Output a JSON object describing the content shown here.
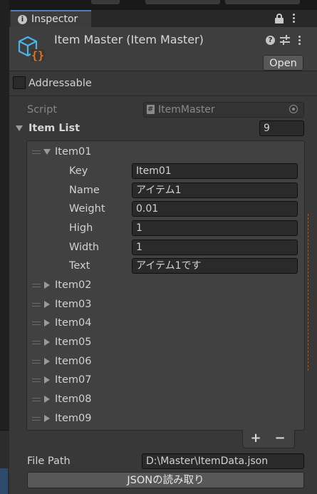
{
  "tab": {
    "title": "Inspector"
  },
  "header": {
    "title": "Item Master (Item Master)",
    "open_label": "Open"
  },
  "addressable": {
    "label": "Addressable",
    "checked": false
  },
  "script": {
    "label": "Script",
    "value": "ItemMaster"
  },
  "item_list": {
    "label": "Item List",
    "count": "9",
    "expanded_item": {
      "name": "Item01",
      "fields": [
        {
          "label": "Key",
          "value": "Item01"
        },
        {
          "label": "Name",
          "value": "アイテム1"
        },
        {
          "label": "Weight",
          "value": "0.01"
        },
        {
          "label": "High",
          "value": "1"
        },
        {
          "label": "Width",
          "value": "1"
        },
        {
          "label": "Text",
          "value": "アイテム1です"
        }
      ]
    },
    "collapsed_items": [
      "Item02",
      "Item03",
      "Item04",
      "Item05",
      "Item06",
      "Item07",
      "Item08",
      "Item09"
    ],
    "add_label": "+",
    "remove_label": "−"
  },
  "file_path": {
    "label": "File Path",
    "value": "D:\\Master\\ItemData.json"
  },
  "load_button": {
    "label": "JSONの読み取り"
  },
  "colors": {
    "accent_orange": "#e8731f",
    "script_icon_blue": "#4ab4e6"
  },
  "icons": [
    "info-icon",
    "lock-icon",
    "kebab-menu-icon",
    "help-icon",
    "preset-icon",
    "checkbox-icon",
    "script-file-icon",
    "target-icon",
    "drag-handle-icon",
    "foldout-arrow-icon"
  ]
}
